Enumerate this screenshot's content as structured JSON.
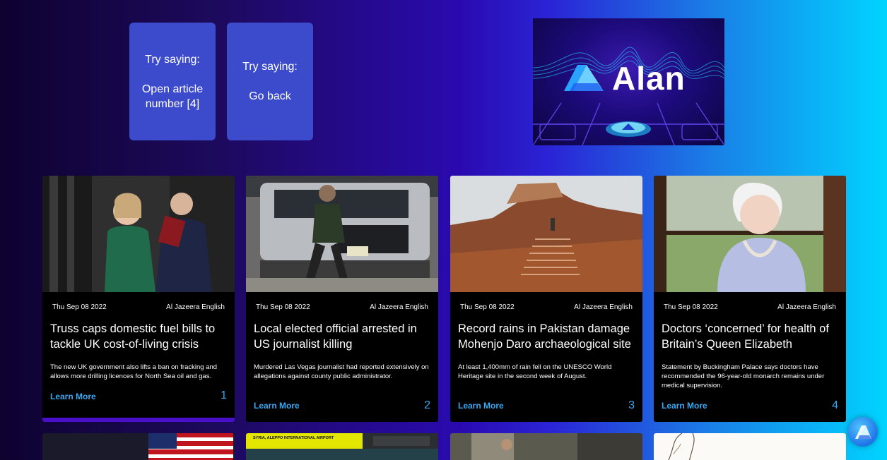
{
  "hints": [
    {
      "label": "Try saying:",
      "text": "Open article number [4]"
    },
    {
      "label": "Try saying:",
      "text": "Go back"
    }
  ],
  "logo": {
    "text": "Alan"
  },
  "articles": [
    {
      "date": "Thu Sep 08 2022",
      "source": "Al Jazeera English",
      "title": "Truss caps domestic fuel bills to tackle UK cost-of-living crisis",
      "description": "The new UK government also lifts a ban on fracking and allows more drilling licences for North Sea oil and gas.",
      "link": "Learn More",
      "number": "1"
    },
    {
      "date": "Thu Sep 08 2022",
      "source": "Al Jazeera English",
      "title": "Local elected official arrested in US journalist killing",
      "description": "Murdered Las Vegas journalist had reported extensively on allegations against county public administrator.",
      "link": "Learn More",
      "number": "2"
    },
    {
      "date": "Thu Sep 08 2022",
      "source": "Al Jazeera English",
      "title": "Record rains in Pakistan damage Mohenjo Daro archaeological site",
      "description": "At least 1,400mm of rain fell on the UNESCO World Heritage site in the second week of August.",
      "link": "Learn More",
      "number": "3"
    },
    {
      "date": "Thu Sep 08 2022",
      "source": "Al Jazeera English",
      "title": "Doctors ‘concerned’ for health of Britain’s Queen Elizabeth",
      "description": "Statement by Buckingham Palace says doctors have recommended the 96-year-old monarch remains under medical supervision.",
      "link": "Learn More",
      "number": "4"
    }
  ],
  "partial_card_caption": "SYRIA, ALEPPO INTERNATIONAL AIRPORT",
  "colors": {
    "accent": "#3aa9f3",
    "hint_bg": "#3b4bcc",
    "active_underline": "#4a0fc8"
  }
}
